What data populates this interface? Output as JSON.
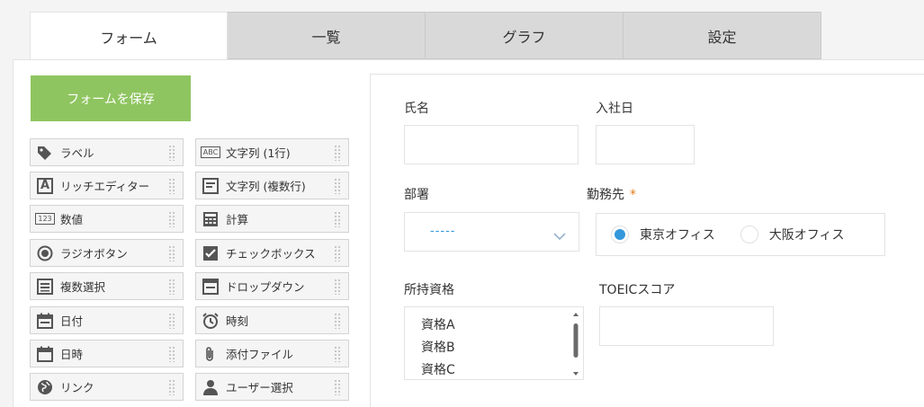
{
  "tabs": [
    {
      "label": "フォーム",
      "active": true
    },
    {
      "label": "一覧",
      "active": false
    },
    {
      "label": "グラフ",
      "active": false
    },
    {
      "label": "設定",
      "active": false
    }
  ],
  "save_button": "フォームを保存",
  "palette": [
    {
      "label": "ラベル",
      "icon": "tag-icon"
    },
    {
      "label": "文字列 (1行)",
      "icon": "abc-icon",
      "icon_text": "ABC"
    },
    {
      "label": "リッチエディター",
      "icon": "rich-editor-icon",
      "icon_text": "A"
    },
    {
      "label": "文字列 (複数行)",
      "icon": "multiline-icon"
    },
    {
      "label": "数値",
      "icon": "number-icon",
      "icon_text": "123"
    },
    {
      "label": "計算",
      "icon": "calculator-icon"
    },
    {
      "label": "ラジオボタン",
      "icon": "radio-icon"
    },
    {
      "label": "チェックボックス",
      "icon": "checkbox-icon"
    },
    {
      "label": "複数選択",
      "icon": "multi-select-icon"
    },
    {
      "label": "ドロップダウン",
      "icon": "dropdown-icon"
    },
    {
      "label": "日付",
      "icon": "date-icon"
    },
    {
      "label": "時刻",
      "icon": "clock-icon"
    },
    {
      "label": "日時",
      "icon": "datetime-icon"
    },
    {
      "label": "添付ファイル",
      "icon": "paperclip-icon"
    },
    {
      "label": "リンク",
      "icon": "globe-icon"
    },
    {
      "label": "ユーザー選択",
      "icon": "user-icon"
    }
  ],
  "form": {
    "name_label": "氏名",
    "name_value": "",
    "hire_date_label": "入社日",
    "hire_date_value": "",
    "department_label": "部署",
    "department_value": "-----",
    "workplace_label": "勤務先",
    "required_mark": "*",
    "workplace_options": [
      {
        "label": "東京オフィス",
        "selected": true
      },
      {
        "label": "大阪オフィス",
        "selected": false
      }
    ],
    "qualifications_label": "所持資格",
    "qualifications": [
      "資格A",
      "資格B",
      "資格C"
    ],
    "toeic_label": "TOEICスコア",
    "toeic_value": ""
  },
  "colors": {
    "accent": "#8fc560",
    "selected": "#3498db",
    "required": "#e07b1a"
  }
}
